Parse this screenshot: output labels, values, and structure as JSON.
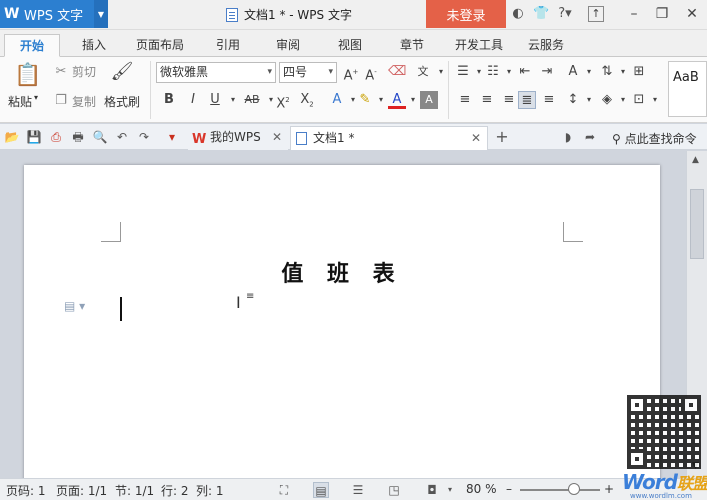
{
  "titlebar": {
    "app_name": "WPS 文字",
    "app_logo": "W",
    "document_title": "文档1 * - WPS 文字",
    "login_label": "未登录",
    "icons": [
      "skin-icon",
      "shirt-icon",
      "help-icon",
      "minimize-icon",
      "restore-icon",
      "close-icon"
    ]
  },
  "tabs": [
    "开始",
    "插入",
    "页面布局",
    "引用",
    "审阅",
    "视图",
    "章节",
    "开发工具",
    "云服务"
  ],
  "active_tab": "开始",
  "ribbon": {
    "paste_label": "粘贴",
    "cut_label": "剪切",
    "copy_label": "复制",
    "format_painter_label": "格式刷",
    "font_name": "微软雅黑",
    "font_size": "四号",
    "style_preview": "AaB"
  },
  "qat": {
    "doc_tabs": [
      {
        "label": "我的WPS",
        "active": false
      },
      {
        "label": "文档1 *",
        "active": true
      }
    ],
    "search_label": "点此查找命令"
  },
  "document": {
    "heading": "值 班 表"
  },
  "statusbar": {
    "page_num": "页码: 1",
    "page": "页面: 1/1",
    "section": "节: 1/1",
    "row": "行: 2",
    "col": "列: 1",
    "zoom": "80 %"
  },
  "watermark": {
    "brand": "Word",
    "brand_cn": "联盟",
    "url": "www.wordlm.com"
  },
  "colors": {
    "accent": "#2c7fd0",
    "login_bg": "#e46148"
  }
}
